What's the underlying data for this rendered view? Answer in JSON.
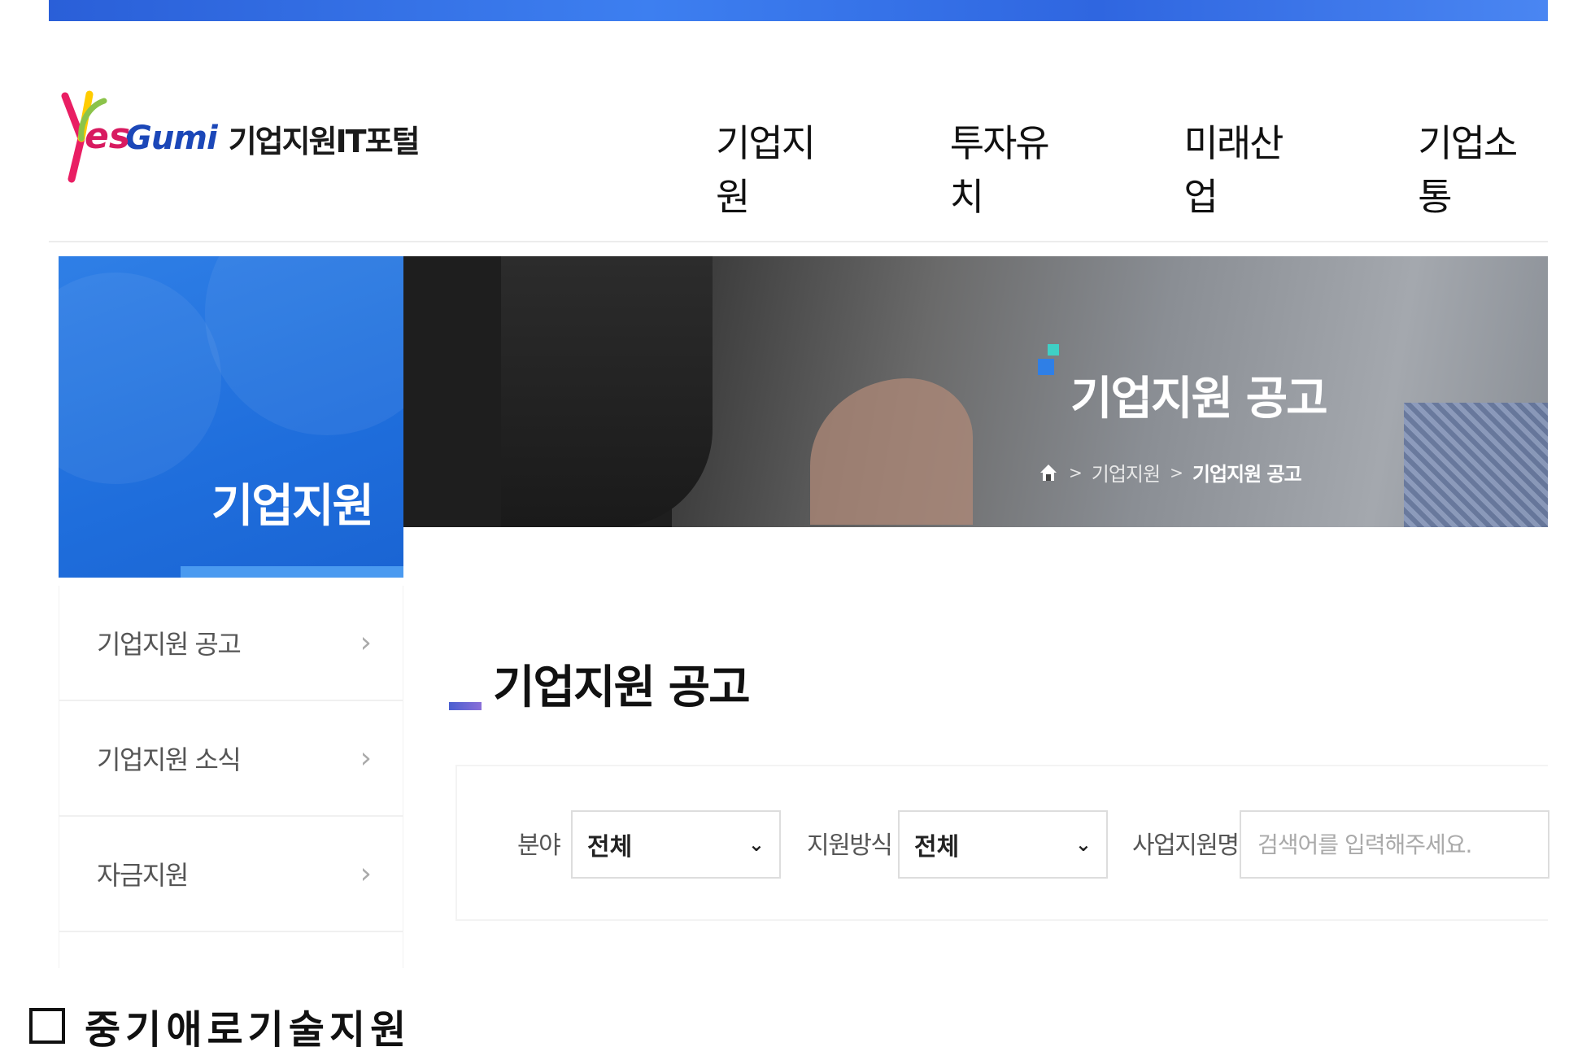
{
  "header": {
    "logo_text_gumi": "Gumi",
    "logo_text_portal": "기업지원IT포털",
    "nav": [
      "기업지원",
      "투자유치",
      "미래산업",
      "기업소통"
    ]
  },
  "side": {
    "section_title": "기업지원",
    "menu": [
      "기업지원 공고",
      "기업지원 소식",
      "자금지원",
      ""
    ]
  },
  "visual": {
    "title": "기업지원 공고",
    "breadcrumb": [
      "기업지원",
      "기업지원 공고"
    ]
  },
  "content": {
    "title": "기업지원 공고",
    "search": {
      "field_label": "분야",
      "field_value": "전체",
      "method_label": "지원방식",
      "method_value": "전체",
      "name_label": "사업지원명",
      "name_placeholder": "검색어를 입력해주세요."
    }
  },
  "caption": {
    "text": "중기애로기술지원"
  },
  "colors": {
    "brand_blue": "#1f6edc",
    "accent_teal": "#3fd0c6"
  }
}
